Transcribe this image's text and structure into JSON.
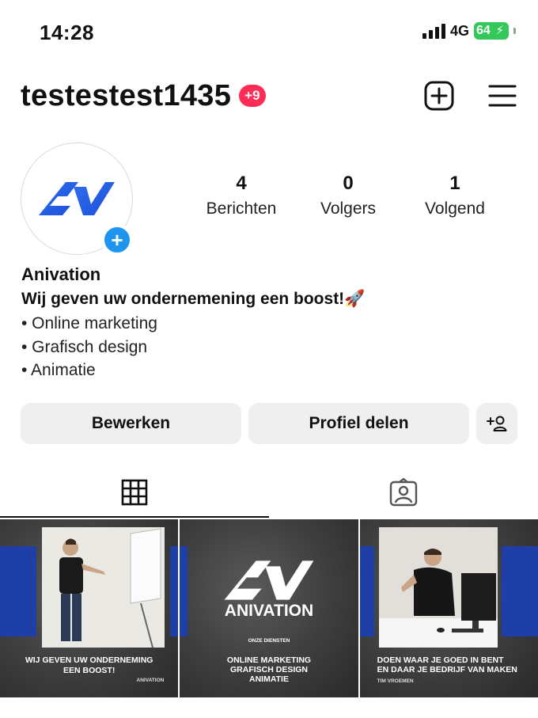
{
  "status_bar": {
    "time": "14:28",
    "network": "4G",
    "battery": "64"
  },
  "header": {
    "username": "testestest1435",
    "notification_count": "+9"
  },
  "profile": {
    "stats": [
      {
        "value": "4",
        "label": "Berichten"
      },
      {
        "value": "0",
        "label": "Volgers"
      },
      {
        "value": "1",
        "label": "Volgend"
      }
    ],
    "display_name": "Anivation",
    "bio_headline": "Wij geven uw ondernemening een boost!🚀",
    "bio_lines": [
      "• Online marketing",
      "• Grafisch design",
      "• Animatie"
    ]
  },
  "actions": {
    "edit": "Bewerken",
    "share": "Profiel delen"
  },
  "posts": [
    {
      "caption_line1": "WIJ GEVEN UW ONDERNEMING",
      "caption_line2": "EEN BOOST!",
      "sub": "ANIVATION"
    },
    {
      "logo_text": "ANIVATION",
      "kicker": "ONZE DIENSTEN",
      "caption_line1": "ONLINE MARKETING",
      "caption_line2": "GRAFISCH DESIGN",
      "caption_line3": "ANIMATIE"
    },
    {
      "caption_line1": "DOEN WAAR JE GOED IN BENT",
      "caption_line2": "EN DAAR JE BEDRIJF VAN MAKEN",
      "sub": "TIM VROEMEN"
    }
  ],
  "colors": {
    "accent_blue": "#1f95f0",
    "badge_red": "#ff2d55",
    "post_blue": "#1e3fa8",
    "battery_green": "#34c759"
  },
  "icons": [
    "signal-icon",
    "battery-icon",
    "new-post-icon",
    "menu-icon",
    "add-story-icon",
    "add-person-icon",
    "grid-icon",
    "tagged-icon",
    "anivation-logo"
  ]
}
